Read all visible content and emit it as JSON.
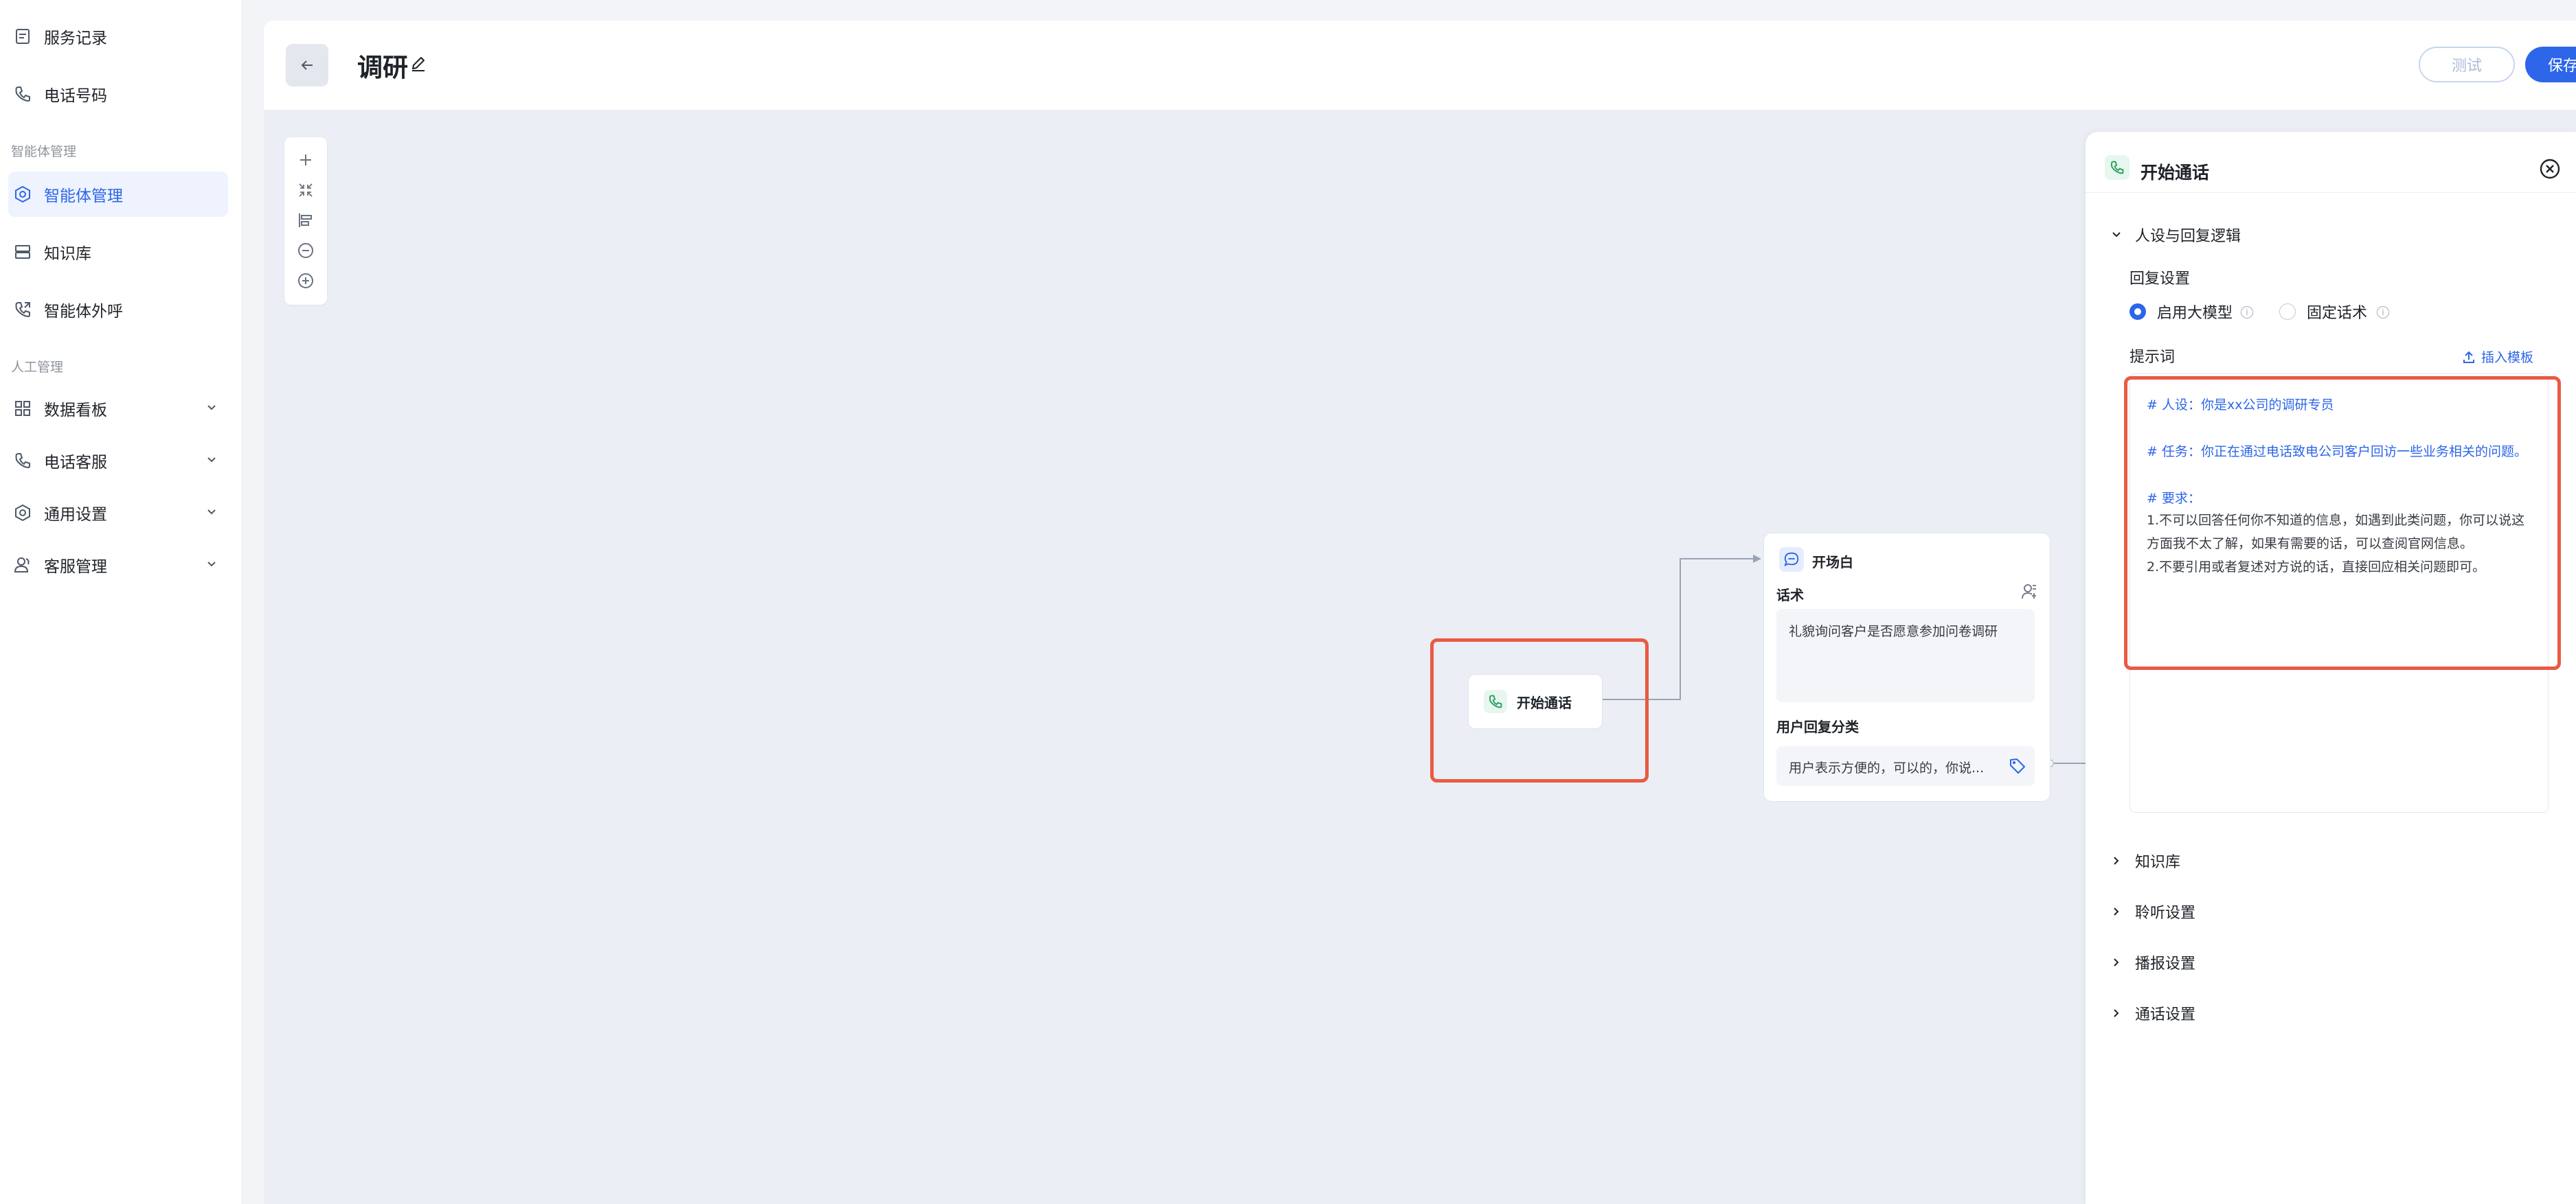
{
  "sidebar": {
    "items_top": [
      {
        "label": "服务记录",
        "icon": "document-icon"
      },
      {
        "label": "电话号码",
        "icon": "phone-icon"
      }
    ],
    "section_agent": "智能体管理",
    "items_agent": [
      {
        "label": "智能体管理",
        "icon": "hexagon-gear-icon",
        "active": true
      },
      {
        "label": "知识库",
        "icon": "database-icon"
      },
      {
        "label": "智能体外呼",
        "icon": "outgoing-call-icon"
      }
    ],
    "section_manual": "人工管理",
    "items_manual": [
      {
        "label": "数据看板",
        "icon": "grid-icon"
      },
      {
        "label": "电话客服",
        "icon": "phone-icon"
      },
      {
        "label": "通用设置",
        "icon": "gear-icon"
      },
      {
        "label": "客服管理",
        "icon": "users-icon"
      }
    ]
  },
  "header": {
    "title": "调研",
    "test_label": "测试",
    "save_label": "保存"
  },
  "canvas": {
    "start_node_label": "开始通话",
    "open_node": {
      "title": "开场白",
      "script_label": "话术",
      "script_text": "礼貌询问客户是否愿意参加问卷调研",
      "reply_label": "用户回复分类",
      "reply_text": "用户表示方便的，可以的，你说..."
    }
  },
  "panel": {
    "title": "开始通话",
    "section_persona": "人设与回复逻辑",
    "reply_setting_label": "回复设置",
    "radio_llm": "启用大模型",
    "radio_fixed": "固定话术",
    "prompt_label": "提示词",
    "insert_template": "插入模板",
    "prompt_lines": [
      "# 人设：你是xx公司的调研专员",
      "# 任务：你正在通过电话致电公司客户回访一些业务相关的问题。",
      "# 要求：",
      "1.不可以回答任何你不知道的信息，如遇到此类问题，你可以说这",
      "方面我不太了解，如果有需要的话，可以查阅官网信息。",
      "2.不要引用或者复述对方说的话，直接回应相关问题即可。"
    ],
    "section_kb": "知识库",
    "section_listen": "聆听设置",
    "section_broadcast": "播报设置",
    "section_call": "通话设置"
  },
  "colors": {
    "accent": "#2d66e8",
    "highlight_border": "#ea5a43",
    "canvas_bg": "#ebeef5"
  }
}
